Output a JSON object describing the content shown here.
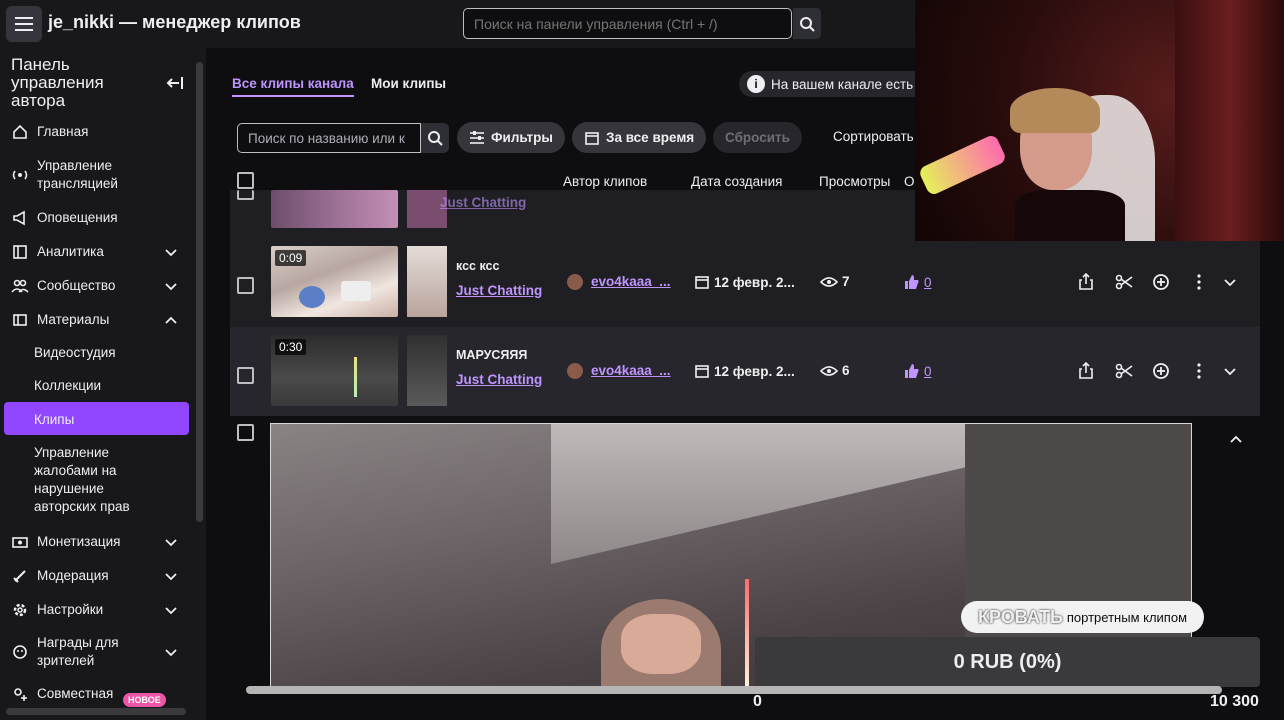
{
  "app": {
    "title": "je_nikki — менеджер клипов"
  },
  "top_search": {
    "placeholder": "Поиск на панели управления (Ctrl + /)"
  },
  "sidebar": {
    "header": "Панель управления автора",
    "items": [
      {
        "label": "Главная",
        "icon": "home-icon"
      },
      {
        "label": "Управление трансляцией",
        "icon": "broadcast-icon"
      },
      {
        "label": "Оповещения",
        "icon": "megaphone-icon"
      },
      {
        "label": "Аналитика",
        "icon": "analytics-icon"
      },
      {
        "label": "Сообщество",
        "icon": "community-icon"
      },
      {
        "label": "Материалы",
        "icon": "content-icon"
      },
      {
        "label": "Монетизация",
        "icon": "money-icon"
      },
      {
        "label": "Модерация",
        "icon": "sword-icon"
      },
      {
        "label": "Настройки",
        "icon": "gear-icon"
      },
      {
        "label": "Награды для зрителей",
        "icon": "reward-icon"
      },
      {
        "label": "Совместная",
        "icon": "collab-icon"
      }
    ],
    "sub_items": [
      "Видеостудия",
      "Коллекции",
      "Клипы",
      "Управление жалобами на нарушение авторских прав"
    ],
    "new_badge": "НОВОЕ"
  },
  "tabs": [
    "Все клипы канала",
    "Мои клипы"
  ],
  "info": "На вашем канале есть",
  "filters": {
    "search_placeholder": "Поиск по названию или к",
    "filters_label": "Фильтры",
    "period_label": "За все время",
    "reset_label": "Сбросить",
    "sort_label": "Сортировать"
  },
  "columns": [
    "Автор клипов",
    "Дата создания",
    "Просмотры",
    "О"
  ],
  "partial_row": {
    "game": "Just Chatting"
  },
  "clips": [
    {
      "duration": "0:09",
      "title": "ксс ксс",
      "game": "Just Chatting",
      "author": "evo4kaaa_...",
      "date": "12 февр. 2...",
      "views": "7",
      "likes": "0"
    },
    {
      "duration": "0:30",
      "title": "МАРУСЯЯЯ",
      "game": "Just Chatting",
      "author": "evo4kaaa_...",
      "date": "12 февр. 2...",
      "views": "6",
      "likes": "0"
    }
  ],
  "overlay": {
    "portrait_text": "портретным клипом",
    "portrait_overlay_word": "КРОВАТЬ",
    "donation": "0 RUB (0%)",
    "goal_start": "0",
    "goal_end": "10 300"
  },
  "colors": {
    "accent": "#9147ff",
    "link": "#bf94ff",
    "bg": "#0e0e10",
    "panel": "#18181b"
  }
}
